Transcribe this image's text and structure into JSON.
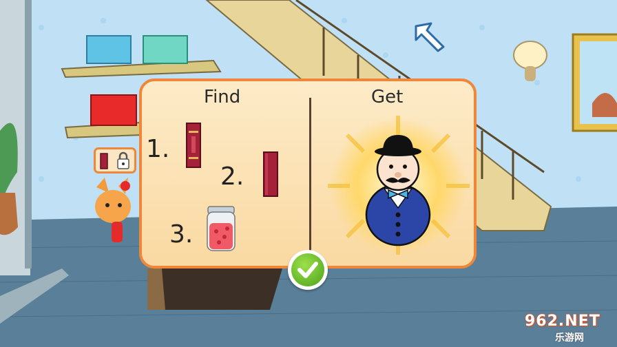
{
  "dialog": {
    "find_title": "Find",
    "get_title": "Get",
    "find_items": [
      {
        "number": "1.",
        "item": "red-book-icon"
      },
      {
        "number": "2.",
        "item": "red-book-icon"
      },
      {
        "number": "3.",
        "item": "jam-jar-icon"
      }
    ],
    "reward": "gentleman-toy-icon",
    "confirm": "checkmark-icon"
  },
  "hud": {
    "back": "back-arrow-icon",
    "locked_slot": [
      "red-book-icon",
      "padlock-icon"
    ]
  },
  "watermark": {
    "brand": "962.NET",
    "subtitle": "乐游网"
  },
  "colors": {
    "panel_border": "#f0863a",
    "panel_fill": "#fbe1b0",
    "confirm_green": "#5bb523",
    "wall": "#bfe0f5",
    "carpet": "#5a7f99"
  }
}
